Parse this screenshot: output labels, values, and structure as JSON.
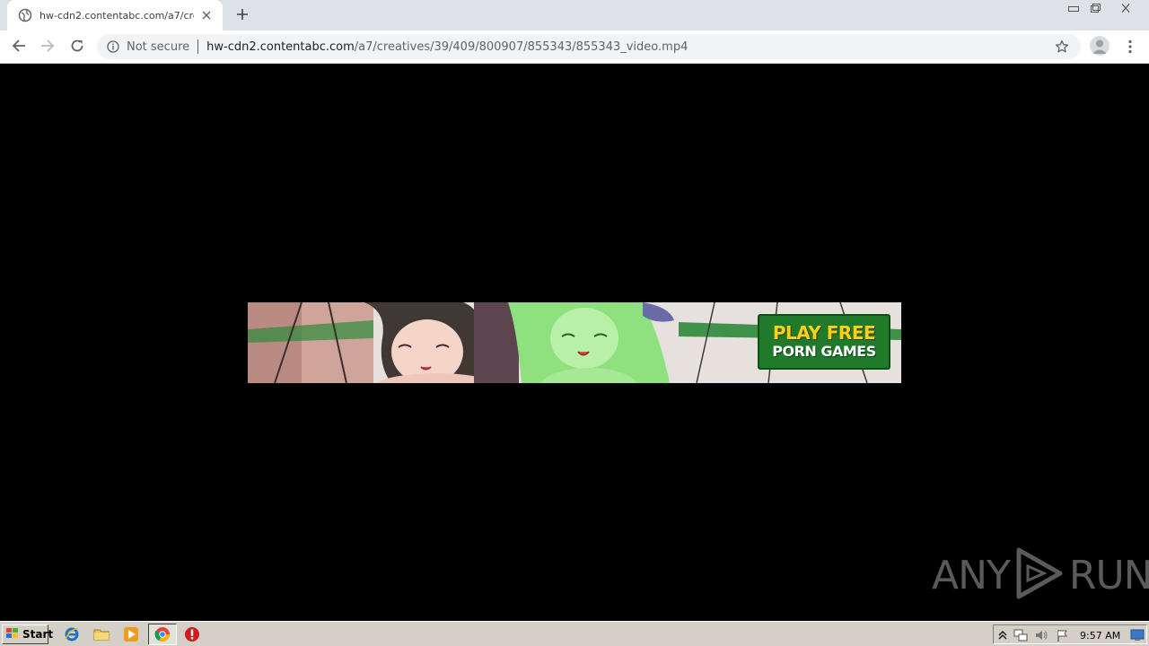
{
  "browser": {
    "tab": {
      "title": "hw-cdn2.contentabc.com/a7/creatives/39/409/800907/855343/855343_video.mp4",
      "favicon": "globe-icon"
    },
    "new_tab_icon": "plus-icon",
    "window_controls": [
      "minimize-icon",
      "restore-icon",
      "close-icon"
    ]
  },
  "toolbar": {
    "back_icon": "back-arrow-icon",
    "forward_icon": "forward-arrow-icon",
    "reload_icon": "reload-icon",
    "security_label": "Not secure",
    "url_host": "hw-cdn2.contentabc.com",
    "url_path": "/a7/creatives/39/409/800907/855343/855343_video.mp4",
    "bookmark_icon": "star-icon",
    "profile_icon": "avatar-icon",
    "menu_icon": "kebab-menu-icon"
  },
  "content": {
    "banner_cta_line1": "PLAY FREE",
    "banner_cta_line2": "PORN GAMES",
    "cta_color": "#1f7a2a",
    "cta_text_color": "#f6d31a"
  },
  "watermark": {
    "text_left": "ANY",
    "text_right": "RUN"
  },
  "taskbar": {
    "start_label": "Start",
    "clock": "9:57 AM",
    "quick_launch": [
      "ie-icon",
      "folder-icon",
      "media-player-icon",
      "chrome-icon",
      "stop-icon"
    ],
    "tray": [
      "tray-expand-icon",
      "network-icon",
      "volume-icon",
      "flag-icon",
      "show-desktop-icon"
    ]
  }
}
